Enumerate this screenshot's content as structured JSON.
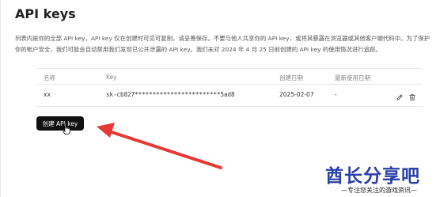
{
  "page": {
    "title": "API keys",
    "description": "列表内是你的全部 API key，API key 仅在创建时可见可复制，请妥善保存。不要与他人共享你的 API key，或将其暴露在浏览器或其他客户端代码中。为了保护你的帐户安全，我们可能会自动禁用我们发现已公开泄露的 API key。我们未对 2024 年 4 月 25 日前创建的 API key 的使用情况进行追踪。"
  },
  "table": {
    "headers": {
      "name": "名称",
      "key": "Key",
      "created": "创建日期",
      "last_used": "最新使用日期"
    },
    "rows": [
      {
        "name": "xx",
        "key": "sk-cb827************************5ad8",
        "created": "2025-02-07",
        "last_used": "-"
      }
    ]
  },
  "actions": {
    "create_label": "创建 API key",
    "edit_icon": "pencil-icon",
    "delete_icon": "trash-icon"
  },
  "watermark": {
    "logo": "酋长分享吧",
    "tagline": "—专注您关注的游戏资讯—"
  },
  "colors": {
    "button_bg": "#111111",
    "arrow": "#e53935",
    "watermark": "#2a3fa8"
  }
}
